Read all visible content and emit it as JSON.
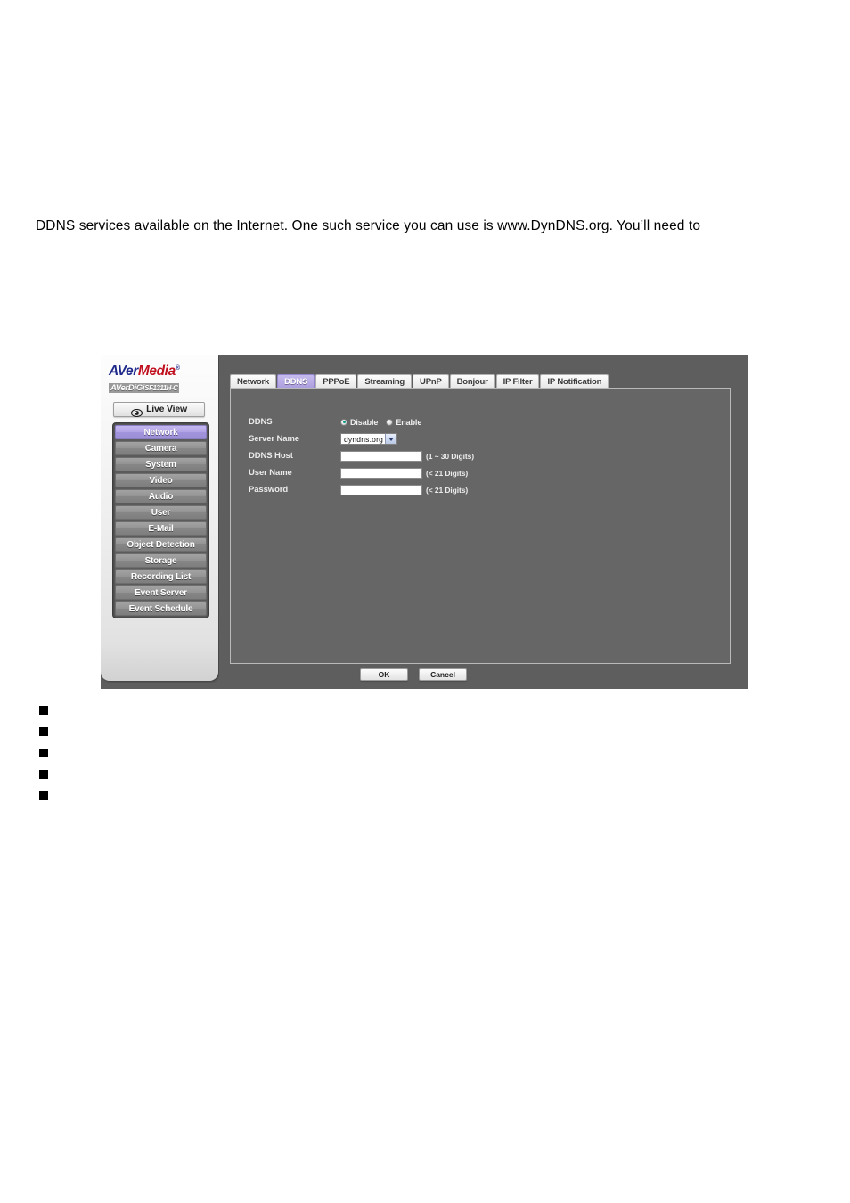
{
  "document": {
    "paragraph": "DDNS services available on the Internet. One such service you can use is www.DynDNS.org. You’ll need to",
    "bullets": [
      "",
      "",
      "",
      "",
      ""
    ]
  },
  "screenshot": {
    "brand": {
      "name_part1": "AVer",
      "name_part2": "Media",
      "trademark": "®",
      "product_line": "AVerDiGi",
      "model": "SF1311H-C"
    },
    "live_view": {
      "label": "Live View",
      "icon": "eye-icon"
    },
    "sidebar": {
      "items": [
        {
          "label": "Network",
          "active": true
        },
        {
          "label": "Camera",
          "active": false
        },
        {
          "label": "System",
          "active": false
        },
        {
          "label": "Video",
          "active": false
        },
        {
          "label": "Audio",
          "active": false
        },
        {
          "label": "User",
          "active": false
        },
        {
          "label": "E-Mail",
          "active": false
        },
        {
          "label": "Object Detection",
          "active": false
        },
        {
          "label": "Storage",
          "active": false
        },
        {
          "label": "Recording List",
          "active": false
        },
        {
          "label": "Event Server",
          "active": false
        },
        {
          "label": "Event Schedule",
          "active": false
        }
      ]
    },
    "tabs": [
      {
        "label": "Network",
        "active": false
      },
      {
        "label": "DDNS",
        "active": true
      },
      {
        "label": "PPPoE",
        "active": false
      },
      {
        "label": "Streaming",
        "active": false
      },
      {
        "label": "UPnP",
        "active": false
      },
      {
        "label": "Bonjour",
        "active": false
      },
      {
        "label": "IP Filter",
        "active": false
      },
      {
        "label": "IP Notification",
        "active": false
      }
    ],
    "form": {
      "ddns": {
        "label": "DDNS",
        "options": [
          {
            "label": "Disable",
            "selected": true
          },
          {
            "label": "Enable",
            "selected": false
          }
        ]
      },
      "server_name": {
        "label": "Server Name",
        "value": "dyndns.org",
        "options": [
          "dyndns.org"
        ]
      },
      "ddns_host": {
        "label": "DDNS Host",
        "value": "",
        "hint": "(1 ~ 30 Digits)"
      },
      "user_name": {
        "label": "User Name",
        "value": "",
        "hint": "(< 21 Digits)"
      },
      "password": {
        "label": "Password",
        "value": "",
        "hint": "(< 21 Digits)"
      }
    },
    "buttons": {
      "ok": "OK",
      "cancel": "Cancel"
    },
    "colors": {
      "accent_purple": "#ab9ddf",
      "panel_gray": "#666666",
      "background_gray": "#5e5e5e",
      "brand_blue": "#1f2a8c",
      "brand_red": "#c01020",
      "radio_selected": "#0c9c84"
    }
  }
}
